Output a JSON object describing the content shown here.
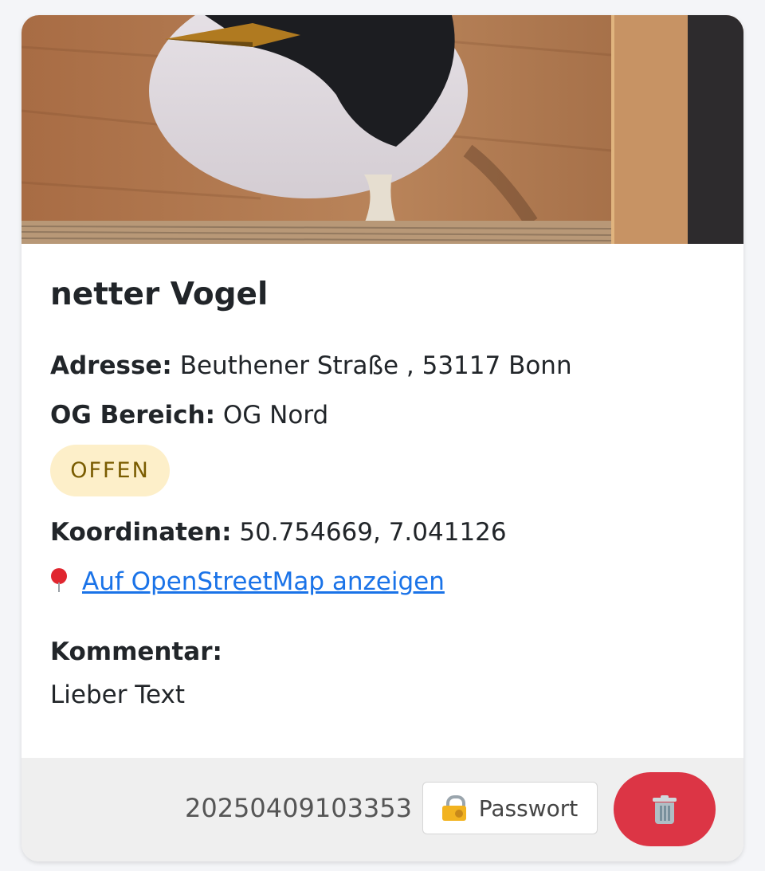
{
  "card": {
    "photo_alt": "",
    "title": "netter Vogel",
    "address_label": "Adresse:",
    "address_value": "Beuthener Straße , 53117 Bonn",
    "og_label": "OG Bereich:",
    "og_value": "OG Nord",
    "status_badge": "OFFEN",
    "coords_label": "Koordinaten:",
    "coords_value": "50.754669, 7.041126",
    "osm_link_text": "Auf OpenStreetMap anzeigen",
    "comment_label": "Kommentar:",
    "comment_text": "Lieber Text"
  },
  "footer": {
    "id": "20250409103353",
    "password_button_label": "Passwort"
  },
  "icons": {
    "location": "pin-icon",
    "password": "lock-icon",
    "delete": "trash-icon"
  },
  "colors": {
    "badge_bg": "#fdefc9",
    "badge_text": "#7a5c00",
    "link": "#1a73e8",
    "delete_button": "#dc3545",
    "footer_bg": "#efefef"
  }
}
